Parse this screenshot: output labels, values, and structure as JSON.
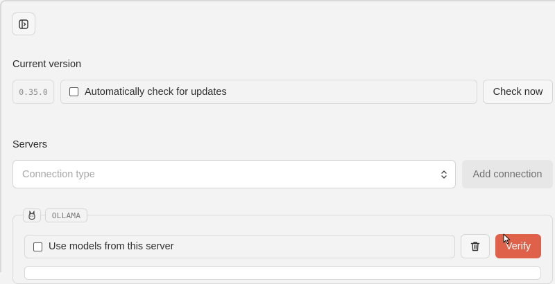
{
  "version": {
    "label": "Current version",
    "value": "0.35.0",
    "auto_check_label": "Automatically check for updates",
    "auto_check_checked": false,
    "check_now_label": "Check now"
  },
  "servers": {
    "label": "Servers",
    "connection_type_placeholder": "Connection type",
    "add_connection_label": "Add connection",
    "items": [
      {
        "type_tag": "OLLAMA",
        "icon": "llama-icon",
        "use_models_label": "Use models from this server",
        "use_models_checked": false,
        "verify_label": "Verify"
      }
    ]
  },
  "colors": {
    "verify_bg": "#e0614a",
    "background": "#f3f3f3"
  }
}
